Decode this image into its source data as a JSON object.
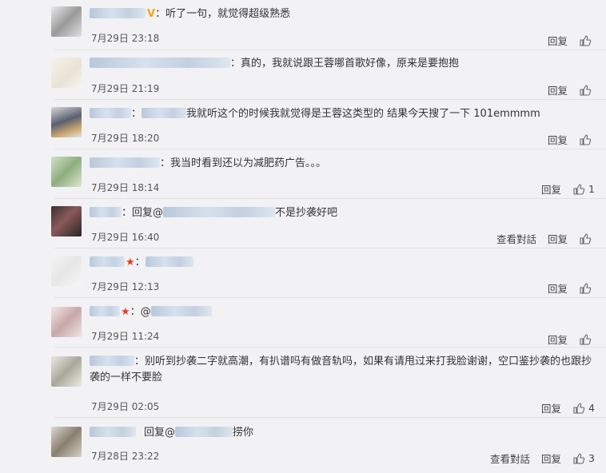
{
  "labels": {
    "reply": "回复",
    "view_dialog": "查看對話"
  },
  "comments": [
    {
      "text": "：听了一句，就觉得超级熟悉",
      "time": "7月29日 23:18",
      "likes": ""
    },
    {
      "text": "：真的，我就说跟王蓉哪首歌好像，原来是要抱抱",
      "time": "7月29日 21:19",
      "likes": ""
    },
    {
      "text_prefix": "：",
      "text": "我就听这个的时候我就觉得是王蓉这类型的 结果今天搜了一下 101emmmm",
      "time": "7月29日 18:20",
      "likes": ""
    },
    {
      "text": "：我当时看到还以为减肥药广告。。。",
      "time": "7月29日 18:14",
      "likes": "1"
    },
    {
      "text_prefix": "：回复@",
      "text": "不是抄袭好吧",
      "time": "7月29日 16:40",
      "likes": ""
    },
    {
      "text": "：",
      "time": "7月29日 12:13",
      "likes": ""
    },
    {
      "text": "：@",
      "time": "7月29日 11:24",
      "likes": ""
    },
    {
      "text": "：别听到抄袭二字就高潮，有扒谱吗有做音轨吗，如果有请甩过来打我脸谢谢，空口鉴抄袭的也跟抄袭的一样不要脸",
      "time": "7月29日 02:05",
      "likes": "4"
    },
    {
      "text_prefix": "回复@",
      "text": "捞你",
      "time": "7月28日 23:22",
      "likes": "3"
    }
  ]
}
